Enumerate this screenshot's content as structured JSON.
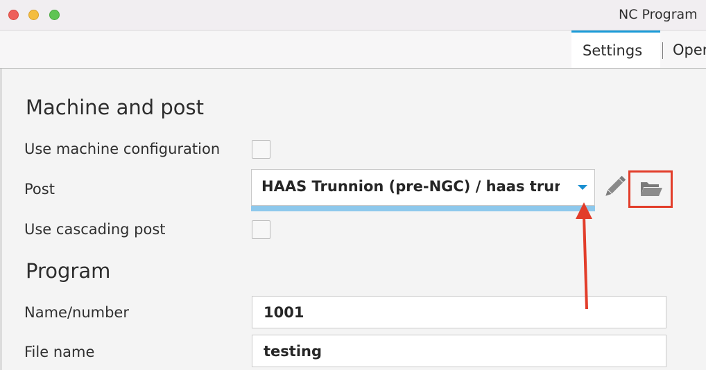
{
  "window": {
    "title": "NC Program"
  },
  "tabs": [
    {
      "label": "Settings",
      "active": true
    },
    {
      "label": "Operations",
      "active": false
    }
  ],
  "machine_and_post": {
    "heading": "Machine and post",
    "use_machine_configuration": {
      "label": "Use machine configuration",
      "checked": false
    },
    "post": {
      "label": "Post",
      "value": "HAAS Trunnion (pre-NGC) / haas trunnion",
      "edit_icon": "pencil-icon",
      "browse_icon": "folder-open-icon"
    },
    "use_cascading_post": {
      "label": "Use cascading post",
      "checked": false
    }
  },
  "program": {
    "heading": "Program",
    "name_number": {
      "label": "Name/number",
      "value": "1001"
    },
    "file_name": {
      "label": "File name",
      "value": "testing"
    }
  },
  "colors": {
    "accent": "#1a9bd8",
    "annotation": "#e23d2a"
  }
}
